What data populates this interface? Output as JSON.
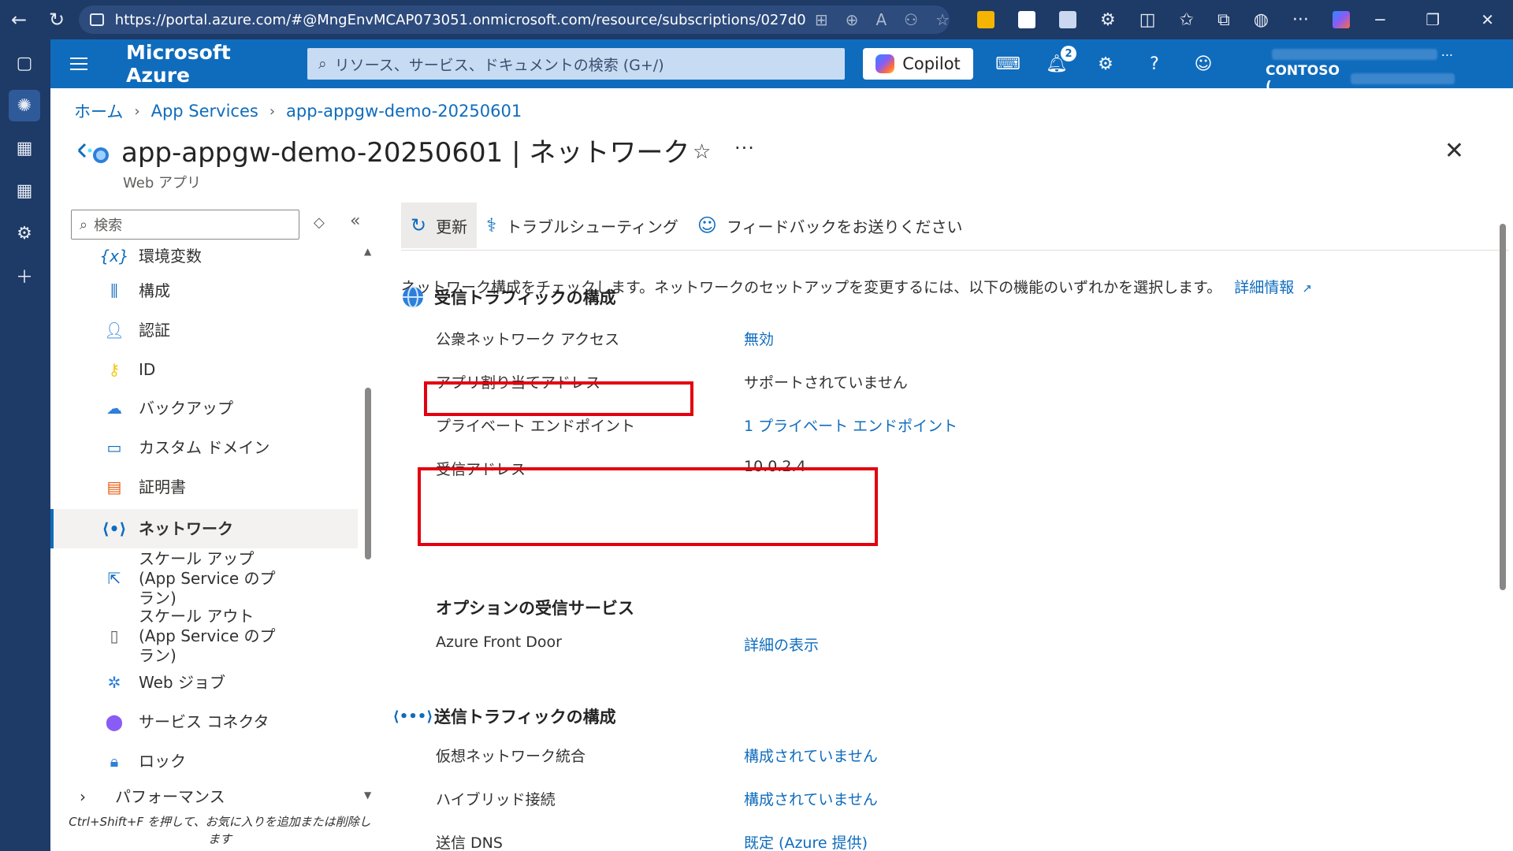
{
  "browser": {
    "url": "https://portal.azure.com/#@MngEnvMCAP073051.onmicrosoft.com/resource/subscriptions/027d0d66-cd43-43d..."
  },
  "header": {
    "brand": "Microsoft Azure",
    "search_placeholder": "リソース、サービス、ドキュメントの検索 (G+/)",
    "copilot_label": "Copilot",
    "notification_count": "2",
    "directory_label": "CONTOSO (",
    "account_more": "..."
  },
  "breadcrumb": [
    "ホーム",
    "App Services",
    "app-appgw-demo-20250601"
  ],
  "page": {
    "title": "app-appgw-demo-20250601 | ネットワーク",
    "subtitle": "Web アプリ",
    "more": "···"
  },
  "menu": {
    "search_placeholder": "検索",
    "items": [
      {
        "label": "環境変数",
        "icon": "env-variables-icon"
      },
      {
        "label": "構成",
        "icon": "configuration-icon"
      },
      {
        "label": "認証",
        "icon": "authentication-icon"
      },
      {
        "label": "ID",
        "icon": "identity-icon"
      },
      {
        "label": "バックアップ",
        "icon": "backup-icon"
      },
      {
        "label": "カスタム ドメイン",
        "icon": "custom-domain-icon"
      },
      {
        "label": "証明書",
        "icon": "certificate-icon"
      },
      {
        "label": "ネットワーク",
        "icon": "networking-icon"
      },
      {
        "label": "スケール アップ (App Service のプラン)",
        "icon": "scale-up-icon"
      },
      {
        "label": "スケール アウト (App Service のプラン)",
        "icon": "scale-out-icon"
      },
      {
        "label": "Web ジョブ",
        "icon": "webjobs-icon"
      },
      {
        "label": "サービス コネクタ",
        "icon": "service-connector-icon"
      },
      {
        "label": "ロック",
        "icon": "lock-icon"
      },
      {
        "label": "パフォーマンス",
        "icon": "chevron-right-icon"
      }
    ],
    "selected": "ネットワーク",
    "hint": "Ctrl+Shift+F を押して、お気に入りを追加または削除します"
  },
  "commands": {
    "refresh": "更新",
    "troubleshoot": "トラブルシューティング",
    "feedback": "フィードバックをお送りください"
  },
  "description": {
    "text": "ネットワーク構成をチェックします。ネットワークのセットアップを変更するには、以下の機能のいずれかを選択します。",
    "link": "詳細情報"
  },
  "inbound": {
    "heading": "受信トラフィックの構成",
    "rows": [
      {
        "label": "公衆ネットワーク アクセス",
        "value": "無効"
      },
      {
        "label": "アプリ割り当てアドレス",
        "value": "サポートされていません"
      },
      {
        "label": "プライベート エンドポイント",
        "value": "1 プライベート エンドポイント"
      },
      {
        "label": "受信アドレス",
        "value": "10.0.2.4"
      }
    ]
  },
  "optional_inbound": {
    "heading": "オプションの受信サービス",
    "rows": [
      {
        "label": "Azure Front Door",
        "value": "詳細の表示"
      }
    ]
  },
  "outbound": {
    "heading": "送信トラフィックの構成",
    "rows": [
      {
        "label": "仮想ネットワーク統合",
        "value": "構成されていません"
      },
      {
        "label": "ハイブリッド接続",
        "value": "構成されていません"
      },
      {
        "label": "送信 DNS",
        "value": "既定 (Azure 提供)"
      }
    ]
  },
  "colors": {
    "azure_blue": "#0f6cbd",
    "highlight_red": "#e3000f",
    "chrome_dark": "#1e3a66"
  }
}
